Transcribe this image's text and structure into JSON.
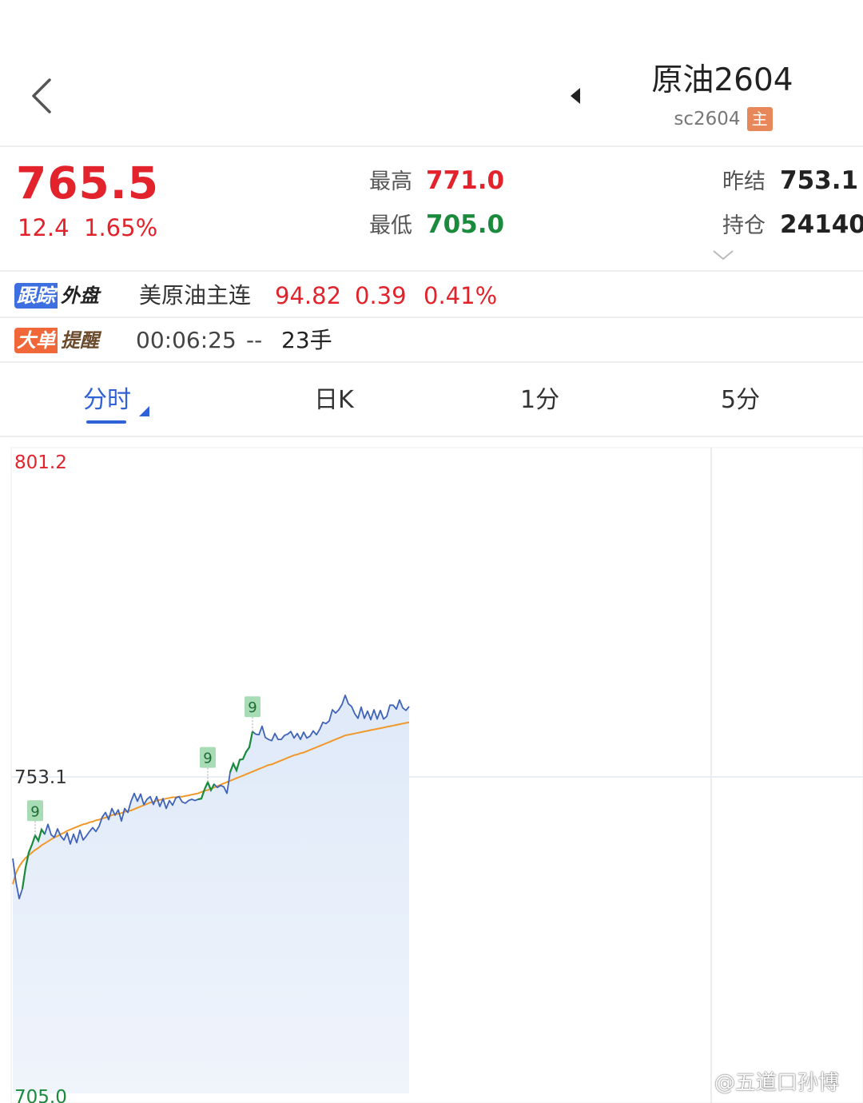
{
  "header": {
    "title": "原油2604",
    "code": "sc2604",
    "badge": "主"
  },
  "quote": {
    "last": "765.5",
    "change": "12.4",
    "change_pct": "1.65%",
    "high_label": "最高",
    "high": "771.0",
    "low_label": "最低",
    "low": "705.0",
    "prev_settle_label": "昨结",
    "prev_settle": "753.1",
    "open_interest_label": "持仓",
    "open_interest": "24140"
  },
  "track": {
    "tag_a": "跟踪",
    "tag_b": "外盘",
    "name": "美原油主连",
    "price": "94.82",
    "change": "0.39",
    "pct": "0.41%"
  },
  "alert": {
    "tag_a": "大单",
    "tag_b": "提醒",
    "time": "00:06:25",
    "direction": "--",
    "qty": "23手"
  },
  "tabs": [
    {
      "label": "分时",
      "active": true
    },
    {
      "label": "日K"
    },
    {
      "label": "1分"
    },
    {
      "label": "5分"
    }
  ],
  "colors": {
    "up": "#e2232b",
    "down": "#1a8a3c",
    "accent": "#2f62d6",
    "price_line": "#3f63b8",
    "avg_line": "#f0982a",
    "fill": "#e7effb"
  },
  "chart_data": {
    "type": "line",
    "ylim": [
      705.0,
      801.2
    ],
    "ytick_labels": [
      "801.2",
      "753.1",
      "705.0"
    ],
    "reference_line": 753.1,
    "series": [
      {
        "values": [
          740.7,
          737.1,
          734.6,
          736.1,
          739.3,
          741.6,
          742.8,
          744.2,
          743.4,
          745.1,
          744.4,
          745.9,
          744.3,
          743.9,
          745.2,
          744.1,
          743.5,
          744.6,
          742.9,
          744.4,
          743.1,
          745.0,
          743.5,
          744.1,
          744.8,
          745.4,
          744.8,
          745.6,
          747.0,
          747.7,
          746.6,
          748.3,
          747.3,
          748.1,
          746.4,
          748.3,
          747.7,
          749.4,
          750.6,
          749.4,
          750.5,
          748.9,
          749.7,
          750.1,
          748.9,
          750.1,
          748.6,
          749.8,
          748.3,
          749.5,
          748.8,
          749.9,
          750.1,
          749.3,
          749.1,
          749.5,
          749.7,
          749.5,
          749.7,
          749.8,
          751.2,
          752.3,
          751.1,
          752.0,
          751.5,
          751.8,
          751.6,
          750.6,
          753.8,
          755.1,
          754.1,
          755.7,
          755.8,
          756.9,
          757.6,
          760.0,
          759.6,
          759.5,
          760.8,
          759.1,
          758.8,
          758.6,
          759.7,
          758.8,
          758.8,
          759.4,
          759.6,
          760.0,
          759.0,
          759.7,
          758.8,
          759.9,
          759.0,
          759.3,
          760.1,
          759.5,
          760.3,
          761.4,
          761.2,
          761.6,
          763.3,
          762.8,
          763.3,
          764.1,
          765.5,
          764.2,
          763.8,
          762.7,
          762.0,
          763.7,
          762.0,
          763.1,
          761.8,
          763.3,
          761.9,
          763.2,
          761.9,
          762.3,
          764.0,
          764.0,
          763.4,
          764.8,
          763.6,
          763.2,
          763.8
        ]
      },
      {
        "values": [
          736.8,
          738.5,
          739.5,
          740.2,
          740.8,
          741.2,
          741.6,
          742.0,
          742.3,
          742.7,
          743.0,
          743.3,
          743.6,
          743.9,
          744.1,
          744.4,
          744.6,
          744.9,
          745.1,
          745.3,
          745.5,
          745.7,
          745.9,
          746.0,
          746.2,
          746.3,
          746.5,
          746.6,
          746.8,
          746.9,
          747.1,
          747.3,
          747.4,
          747.5,
          747.6,
          747.8,
          747.9,
          748.0,
          748.2,
          748.4,
          748.6,
          748.8,
          749.0,
          749.2,
          749.3,
          749.5,
          749.6,
          749.7,
          749.8,
          749.9,
          750.0,
          750.0,
          750.1,
          750.1,
          750.2,
          750.3,
          750.4,
          750.5,
          750.6,
          750.8,
          751.0,
          751.1,
          751.3,
          751.5,
          751.7,
          751.9,
          752.1,
          752.3,
          752.5,
          752.7,
          752.9,
          753.1,
          753.3,
          753.5,
          753.7,
          753.9,
          754.1,
          754.3,
          754.5,
          754.7,
          754.9,
          755.0,
          755.2,
          755.4,
          755.6,
          755.8,
          756.0,
          756.2,
          756.4,
          756.5,
          756.7,
          756.8,
          757.0,
          757.2,
          757.4,
          757.6,
          757.8,
          758.0,
          758.2,
          758.4,
          758.6,
          758.8,
          759.0,
          759.2,
          759.4,
          759.5,
          759.6,
          759.7,
          759.8,
          759.9,
          760.0,
          760.1,
          760.2,
          760.3,
          760.4,
          760.5,
          760.6,
          760.7,
          760.8,
          760.9,
          761.0,
          761.1,
          761.2,
          761.3,
          761.4
        ]
      }
    ],
    "markers": [
      {
        "label": "9",
        "index": 7
      },
      {
        "label": "9",
        "index": 61
      },
      {
        "label": "9",
        "index": 75
      }
    ]
  },
  "watermark": {
    "text": "@五道口孙博"
  }
}
